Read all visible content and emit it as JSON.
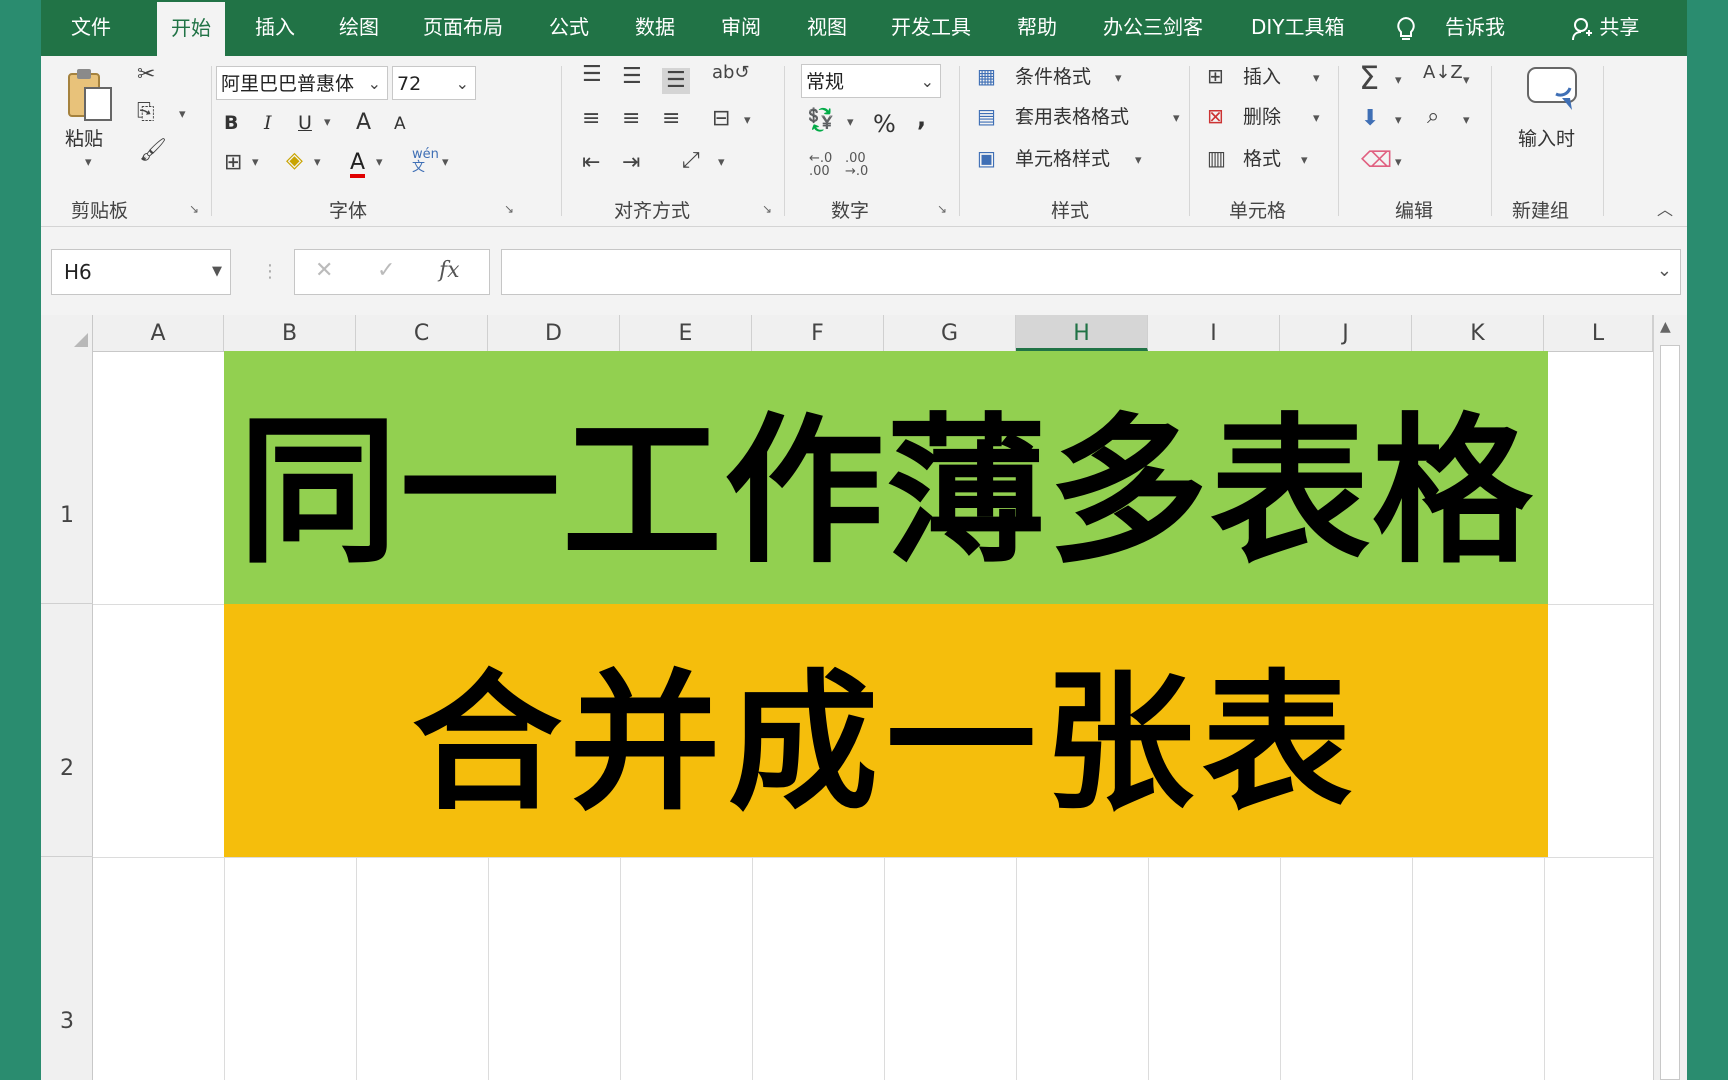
{
  "tabs": [
    "文件",
    "开始",
    "插入",
    "绘图",
    "页面布局",
    "公式",
    "数据",
    "审阅",
    "视图",
    "开发工具",
    "帮助",
    "办公三剑客",
    "DIY工具箱"
  ],
  "active_tab": "开始",
  "tellme_label": "告诉我",
  "share_label": "共享",
  "ribbon": {
    "clipboard": {
      "label": "剪贴板",
      "paste": "粘贴"
    },
    "font": {
      "label": "字体",
      "name": "阿里巴巴普惠体",
      "size": "72",
      "bold": "B",
      "italic": "I",
      "underline": "U",
      "grow": "A",
      "shrink": "A",
      "wen": "wén\n文"
    },
    "alignment": {
      "label": "对齐方式"
    },
    "number": {
      "label": "数字",
      "format": "常规",
      "percent": "%",
      "comma": ","
    },
    "styles": {
      "label": "样式",
      "conditional": "条件格式",
      "table": "套用表格格式",
      "cell_styles": "单元格样式"
    },
    "cells": {
      "label": "单元格",
      "insert": "插入",
      "delete": "删除",
      "format": "格式"
    },
    "editing": {
      "label": "编辑"
    },
    "new_group": {
      "label": "新建组",
      "input": "输入时"
    }
  },
  "formula_bar": {
    "name_box": "H6",
    "fx": "fx",
    "value": ""
  },
  "columns": [
    "A",
    "B",
    "C",
    "D",
    "E",
    "F",
    "G",
    "H",
    "I",
    "J",
    "K",
    "L"
  ],
  "selected_column": "H",
  "rows": [
    "1",
    "2",
    "3"
  ],
  "cells": {
    "row1": "同一工作薄多表格",
    "row2": "合并成一张表"
  },
  "colors": {
    "ribbon_green": "#217346",
    "banner_green": "#92d050",
    "banner_yellow": "#f5be0c",
    "backdrop": "#2a8c6f"
  }
}
